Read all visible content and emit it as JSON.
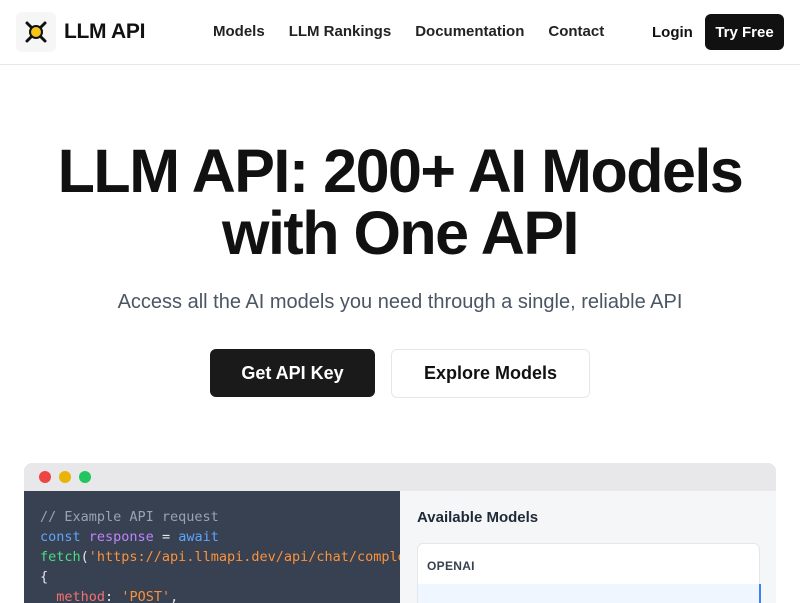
{
  "header": {
    "brand": "LLM API",
    "nav": [
      "Models",
      "LLM Rankings",
      "Documentation",
      "Contact"
    ],
    "login": "Login",
    "try_free": "Try Free"
  },
  "hero": {
    "title_line1": "LLM API: 200+ AI Models",
    "title_line2": "with One API",
    "subtitle": "Access all the AI models you need through a single, reliable API",
    "primary_cta": "Get API Key",
    "secondary_cta": "Explore Models"
  },
  "demo": {
    "code": {
      "comment": "// Example API request",
      "kw_const": "const",
      "var_response": "response",
      "op_eq": "=",
      "kw_await": "await",
      "fn_fetch": "fetch",
      "paren_open": "(",
      "url": "'https://api.llmapi.dev/api/chat/completions'",
      "brace_open": "{",
      "prop_method": "method",
      "colon": ":",
      "str_post": "'POST'",
      "comma": ","
    },
    "models_title": "Available Models",
    "provider": "OPENAI"
  },
  "colors": {
    "accent": "#111111",
    "code_bg": "#374151",
    "selected_row": "#eff6ff",
    "selected_border": "#3b82f6"
  }
}
